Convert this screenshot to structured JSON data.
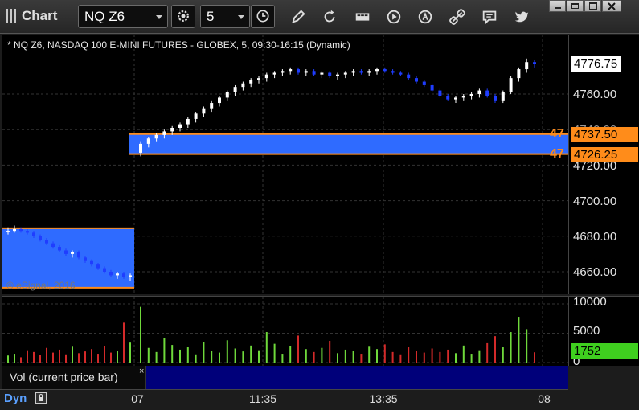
{
  "window": {
    "title": "Chart"
  },
  "toolbar": {
    "symbol": "NQ Z6",
    "interval": "5",
    "icons": [
      "settings-icon",
      "clock-icon",
      "pencil-icon",
      "refresh-icon",
      "news-icon",
      "play-icon",
      "alert-icon",
      "link-icon",
      "comment-icon",
      "twitter-icon"
    ]
  },
  "chart": {
    "header": "* NQ Z6, NASDAQ 100 E-MINI FUTURES - GLOBEX, 5, 09:30-16:15 (Dynamic)",
    "watermark": "© eSignal, 2016",
    "price_labels": [
      "4760.00",
      "4740.00",
      "4720.00",
      "4700.00",
      "4680.00",
      "4660.00"
    ],
    "last_price": "4776.75",
    "zone_high": "4737.50",
    "zone_low": "4726.25",
    "zone_side_label_top": "47",
    "zone_side_label_bottom": "47",
    "colors": {
      "zone": "#2f6bff",
      "zone_line": "#ff8c1a",
      "up": "#ffffff",
      "down": "#1f3dff"
    }
  },
  "volume": {
    "study_label": "Vol (current price bar)",
    "close_symbol": "×",
    "axis_labels": [
      "10000",
      "5000",
      "0"
    ],
    "current_value": "1752"
  },
  "time_axis": {
    "mode_label": "Dyn",
    "labels": [
      "07",
      "11:35",
      "13:35",
      "08"
    ]
  },
  "chart_data": {
    "type": "candlestick",
    "ylim": [
      4650,
      4790
    ],
    "candles_day1": [
      [
        4683,
        4685,
        4681,
        4683
      ],
      [
        4683,
        4686,
        4682,
        4684
      ],
      [
        4684,
        4685,
        4682,
        4683
      ],
      [
        4683,
        4684,
        4681,
        4682
      ],
      [
        4682,
        4683,
        4679,
        4680
      ],
      [
        4680,
        4681,
        4677,
        4678
      ],
      [
        4678,
        4679,
        4675,
        4676
      ],
      [
        4676,
        4677,
        4673,
        4674
      ],
      [
        4674,
        4675,
        4671,
        4672
      ],
      [
        4672,
        4673,
        4669,
        4670
      ],
      [
        4670,
        4672,
        4668,
        4671
      ],
      [
        4671,
        4672,
        4667,
        4668
      ],
      [
        4668,
        4669,
        4665,
        4666
      ],
      [
        4666,
        4667,
        4663,
        4664
      ],
      [
        4664,
        4665,
        4661,
        4662
      ],
      [
        4662,
        4663,
        4659,
        4660
      ],
      [
        4660,
        4661,
        4657,
        4658
      ],
      [
        4658,
        4660,
        4656,
        4659
      ],
      [
        4659,
        4660,
        4656,
        4657
      ],
      [
        4657,
        4659,
        4655,
        4658
      ]
    ],
    "candles_day2": [
      [
        4727,
        4733,
        4725,
        4732
      ],
      [
        4732,
        4736,
        4730,
        4735
      ],
      [
        4735,
        4738,
        4733,
        4737
      ],
      [
        4737,
        4740,
        4735,
        4739
      ],
      [
        4739,
        4742,
        4737,
        4741
      ],
      [
        4741,
        4744,
        4739,
        4743
      ],
      [
        4743,
        4747,
        4741,
        4746
      ],
      [
        4746,
        4750,
        4744,
        4749
      ],
      [
        4749,
        4753,
        4747,
        4752
      ],
      [
        4752,
        4756,
        4750,
        4755
      ],
      [
        4755,
        4759,
        4753,
        4758
      ],
      [
        4758,
        4762,
        4756,
        4761
      ],
      [
        4761,
        4765,
        4759,
        4764
      ],
      [
        4764,
        4767,
        4762,
        4766
      ],
      [
        4766,
        4769,
        4764,
        4768
      ],
      [
        4768,
        4770,
        4766,
        4769
      ],
      [
        4769,
        4772,
        4767,
        4771
      ],
      [
        4771,
        4773,
        4769,
        4772
      ],
      [
        4772,
        4774,
        4770,
        4773
      ],
      [
        4773,
        4775,
        4771,
        4774
      ],
      [
        4774,
        4775,
        4771,
        4772
      ],
      [
        4772,
        4774,
        4770,
        4773
      ],
      [
        4773,
        4774,
        4770,
        4771
      ],
      [
        4771,
        4773,
        4769,
        4772
      ],
      [
        4772,
        4773,
        4769,
        4770
      ],
      [
        4770,
        4772,
        4768,
        4771
      ],
      [
        4771,
        4773,
        4769,
        4772
      ],
      [
        4772,
        4774,
        4770,
        4773
      ],
      [
        4773,
        4774,
        4771,
        4772
      ],
      [
        4772,
        4774,
        4770,
        4773
      ],
      [
        4773,
        4775,
        4771,
        4774
      ],
      [
        4774,
        4775,
        4772,
        4773
      ],
      [
        4773,
        4774,
        4771,
        4772
      ],
      [
        4772,
        4773,
        4770,
        4771
      ],
      [
        4771,
        4772,
        4768,
        4769
      ],
      [
        4769,
        4770,
        4766,
        4767
      ],
      [
        4767,
        4768,
        4764,
        4765
      ],
      [
        4765,
        4766,
        4761,
        4762
      ],
      [
        4762,
        4763,
        4758,
        4759
      ],
      [
        4759,
        4760,
        4756,
        4757
      ],
      [
        4757,
        4759,
        4755,
        4758
      ],
      [
        4758,
        4760,
        4756,
        4759
      ],
      [
        4759,
        4761,
        4757,
        4760
      ],
      [
        4760,
        4763,
        4758,
        4762
      ],
      [
        4762,
        4763,
        4758,
        4759
      ],
      [
        4759,
        4760,
        4755,
        4756
      ],
      [
        4756,
        4762,
        4755,
        4761
      ],
      [
        4761,
        4770,
        4760,
        4769
      ],
      [
        4769,
        4775,
        4767,
        4774
      ],
      [
        4774,
        4780,
        4772,
        4778
      ],
      [
        4778,
        4779,
        4775,
        4777
      ]
    ],
    "volume_day1": [
      1200,
      1500,
      900,
      2100,
      1800,
      1300,
      2500,
      1700,
      2200,
      1400,
      2700,
      1600,
      1900,
      2300,
      1500,
      2800,
      1700,
      2000,
      6800,
      3400
    ],
    "volume_day2": [
      9500,
      2500,
      1800,
      4200,
      3000,
      2200,
      2600,
      1400,
      3500,
      2000,
      1700,
      3800,
      2400,
      1900,
      2900,
      2100,
      5200,
      3200,
      1500,
      2800,
      4600,
      2300,
      1800,
      2500,
      3700,
      1600,
      2200,
      2000,
      1500,
      2700,
      2300,
      3100,
      1800,
      1400,
      2600,
      2000,
      1700,
      2400,
      1800,
      2200,
      1600,
      2900,
      1500,
      2100,
      3300,
      4500,
      2600,
      5200,
      7800,
      5700,
      1750
    ]
  }
}
